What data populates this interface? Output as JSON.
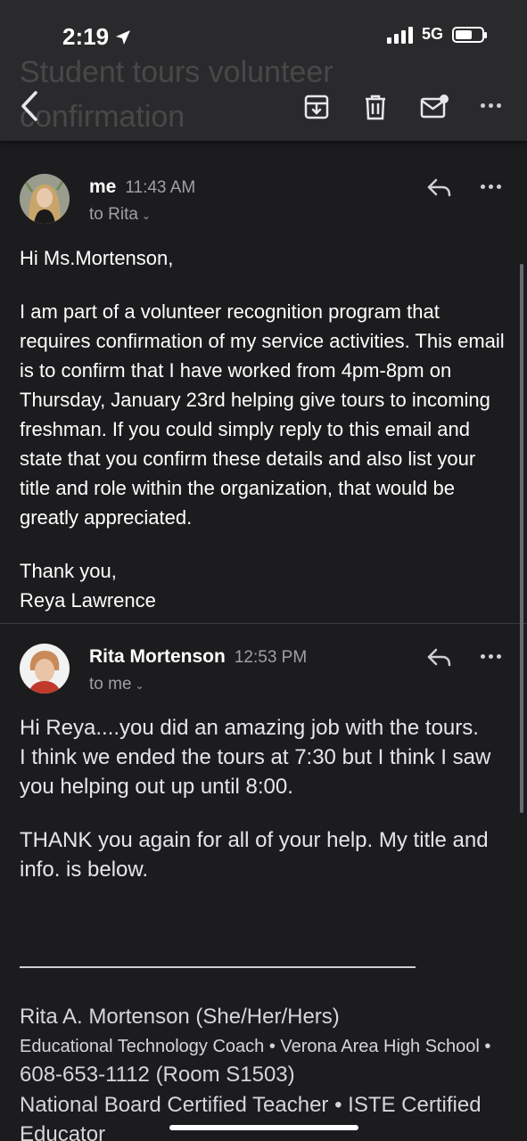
{
  "status_bar": {
    "time": "2:19",
    "network": "5G"
  },
  "header": {
    "subject": "Student tours volunteer confirmation",
    "icons": [
      "back-icon",
      "archive-icon",
      "trash-icon",
      "mark-unread-icon",
      "more-icon"
    ]
  },
  "messages": [
    {
      "sender": "me",
      "time": "11:43 AM",
      "recipient": "to Rita",
      "avatar": "avatar-me",
      "paragraphs": [
        "Hi Ms.Mortenson,",
        "I am part of a volunteer recognition program that requires confirmation of my service activities. This email is to confirm that I have worked from 4pm-8pm on Thursday, January 23rd helping give tours to incoming freshman. If you could simply reply to this email and state that you confirm these details and also list your title and role within the organization, that would be greatly appreciated."
      ],
      "closing_1": "Thank you,",
      "closing_2": "Reya Lawrence"
    },
    {
      "sender": "Rita Mortenson",
      "time": "12:53 PM",
      "recipient": "to me",
      "avatar": "avatar-rita",
      "line_1": "Hi Reya....you did an amazing job with the tours.",
      "line_2": "I think we ended the tours at 7:30 but I think I saw you helping out up until 8:00.",
      "line_3": "THANK you again for all of your help.  My title and info. is below.",
      "signature": {
        "name": "Rita A. Mortenson (She/Her/Hers)",
        "role_part1": "Educational Technology Coach • Verona Area High School •",
        "phone": "608-653-1112 (Room S1503)",
        "certification": "National Board Certified Teacher • ISTE Certified Educator"
      }
    }
  ]
}
